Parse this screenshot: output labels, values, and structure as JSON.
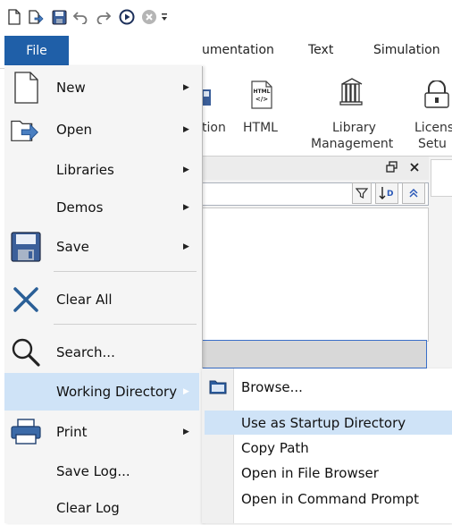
{
  "quick_access": {
    "icons": [
      "new-file-icon",
      "open-icon",
      "save-icon",
      "undo-icon",
      "redo-icon",
      "run-icon",
      "stop-icon",
      "customize-dropdown-icon"
    ]
  },
  "ribbon_tabs": {
    "file": "File",
    "documentation": "umentation",
    "text": "Text",
    "simulation": "Simulation"
  },
  "ribbon": {
    "btn1_label": "tion",
    "html_label": "HTML",
    "html_icon_text": "HTML",
    "library_label_1": "Library",
    "library_label_2": "Management",
    "license_label_1": "Licens",
    "license_label_2": "Setu"
  },
  "file_menu": {
    "items": [
      {
        "label": "New",
        "has_submenu": true,
        "icon": "new-file-icon"
      },
      {
        "label": "Open",
        "has_submenu": true,
        "icon": "open-folder-icon"
      },
      {
        "label": "Libraries",
        "has_submenu": true,
        "icon": ""
      },
      {
        "label": "Demos",
        "has_submenu": true,
        "icon": ""
      },
      {
        "label": "Save",
        "has_submenu": true,
        "icon": "save-disk-icon"
      },
      {
        "label": "Clear All",
        "has_submenu": false,
        "icon": "clear-x-icon"
      },
      {
        "label": "Search...",
        "has_submenu": false,
        "icon": "magnifier-icon"
      },
      {
        "label": "Working Directory",
        "has_submenu": true,
        "icon": ""
      },
      {
        "label": "Print",
        "has_submenu": true,
        "icon": "printer-icon"
      },
      {
        "label": "Save Log...",
        "has_submenu": false,
        "icon": ""
      },
      {
        "label": "Clear Log",
        "has_submenu": false,
        "icon": ""
      }
    ]
  },
  "working_directory_submenu": {
    "items": [
      {
        "label": "Browse...",
        "icon": "folder-icon"
      },
      {
        "label": "Use as Startup Directory",
        "highlighted": true
      },
      {
        "label": "Copy Path"
      },
      {
        "label": "Open in File Browser"
      },
      {
        "label": "Open in Command Prompt"
      }
    ]
  },
  "colors": {
    "file_tab": "#1f5fa8",
    "hover": "#cfe3f7",
    "selection_border": "#3a6fc9"
  }
}
